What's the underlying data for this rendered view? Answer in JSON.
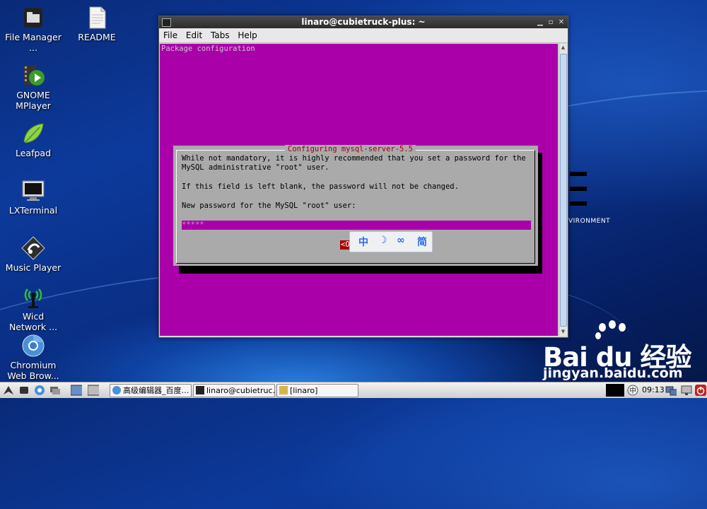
{
  "desktop": {
    "icons": [
      {
        "label": "File Manager ...",
        "icon": "file-manager-icon"
      },
      {
        "label": "README",
        "icon": "text-document-icon"
      },
      {
        "label": "GNOME MPlayer",
        "icon": "mplayer-icon"
      },
      {
        "label": "Leafpad",
        "icon": "leafpad-icon"
      },
      {
        "label": "LXTerminal",
        "icon": "terminal-icon"
      },
      {
        "label": "Music Player",
        "icon": "music-player-icon"
      },
      {
        "label": "Wicd Network ...",
        "icon": "wicd-icon"
      },
      {
        "label": "Chromium Web Brow...",
        "icon": "chromium-icon"
      }
    ],
    "background_logo_text": "VIRONMENT"
  },
  "window": {
    "title": "linaro@cubietruck-plus: ~",
    "menu": [
      "File",
      "Edit",
      "Tabs",
      "Help"
    ]
  },
  "terminal": {
    "header": "Package configuration",
    "dialog": {
      "title": "Configuring mysql-server-5.5",
      "line1": "While not mandatory, it is highly recommended that you set a password for the",
      "line2": "MySQL administrative \"root\" user.",
      "line3": "If this field is left blank, the password will not be changed.",
      "line4": "New password for the MySQL \"root\" user:",
      "password_value": "*****",
      "ok_label": "<Ok>"
    },
    "colors": {
      "background": "#aa00aa",
      "dialog": "#aaaaaa",
      "title_red": "#aa0000"
    }
  },
  "ime_toolbar": [
    "中",
    "☽",
    "∞",
    "简"
  ],
  "watermark": {
    "logo": "Bai du 经验",
    "url": "jingyan.baidu.com"
  },
  "taskbar": {
    "tasks": [
      {
        "label": "高级编辑器_百度…",
        "icon": "chromium-icon"
      },
      {
        "label": "linaro@cubietruc…",
        "icon": "terminal-icon"
      },
      {
        "label": "[linaro]",
        "icon": "folder-icon"
      }
    ],
    "clock": "09:13"
  }
}
